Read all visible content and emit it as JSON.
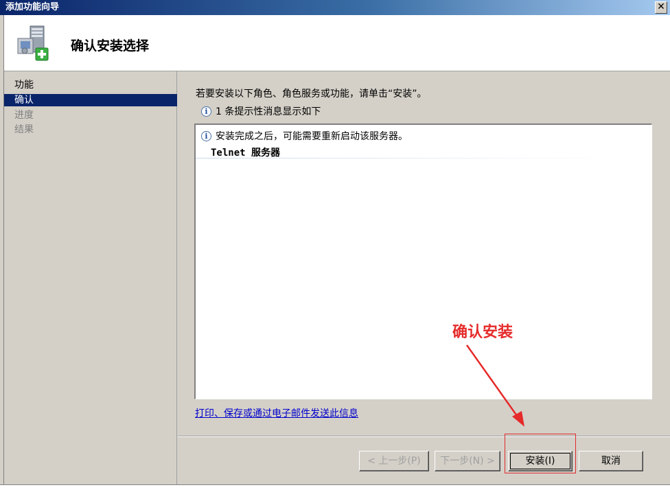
{
  "window": {
    "title": "添加功能向导",
    "close_glyph": "✕"
  },
  "header": {
    "title": "确认安装选择",
    "icon": "server-add-icon"
  },
  "sidebar": {
    "items": [
      {
        "label": "功能",
        "state": "normal"
      },
      {
        "label": "确认",
        "state": "active"
      },
      {
        "label": "进度",
        "state": "disabled"
      },
      {
        "label": "结果",
        "state": "disabled"
      }
    ]
  },
  "content": {
    "intro": "若要安装以下角色、角色服务或功能，请单击“安装”。",
    "info_summary": "1 条提示性消息显示如下",
    "info_icon": "info-icon",
    "messages": [
      {
        "text": "安装完成之后，可能需要重新启动该服务器。"
      }
    ],
    "feature": "Telnet 服务器",
    "print_link": "打印、保存或通过电子邮件发送此信息"
  },
  "buttons": {
    "back": "< 上一步(P)",
    "next": "下一步(N) >",
    "install": "安装(I)",
    "cancel": "取消"
  },
  "annotation": {
    "text": "确认安装",
    "color": "#e52a2a"
  },
  "colors": {
    "selection": "#0a246a",
    "link": "#0000cc",
    "face": "#d4d0c8"
  }
}
